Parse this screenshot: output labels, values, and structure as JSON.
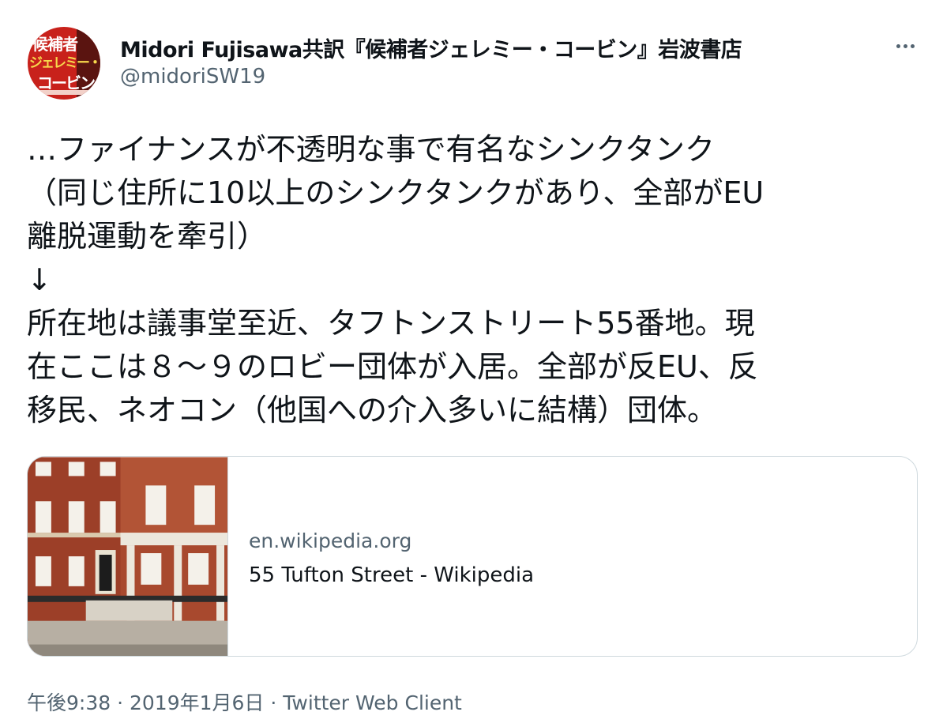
{
  "user": {
    "avatar_text_line1": "候補者",
    "avatar_text_line2": "ジェレミー・",
    "avatar_text_line3": "コービン",
    "display_name": "Midori Fujisawa共訳『候補者ジェレミー・コービン』岩波書店",
    "handle": "@midoriSW19"
  },
  "tweet": {
    "lines": [
      "…ファイナンスが不透明な事で有名なシンクタンク",
      "（同じ住所に10以上のシンクタンクがあり、全部がEU",
      "離脱運動を牽引）",
      "↓",
      "所在地は議事堂至近、タフトンストリート55番地。現",
      "在ここは８〜９のロビー団体が入居。全部が反EU、反",
      "移民、ネオコン（他国への介入多いに結構）団体。"
    ]
  },
  "card": {
    "domain": "en.wikipedia.org",
    "title": "55 Tufton Street - Wikipedia"
  },
  "meta": {
    "time": "午後9:38",
    "date": "2019年1月6日",
    "client": "Twitter Web Client",
    "separator": "·"
  },
  "icons": {
    "more": "more-dots-icon"
  }
}
